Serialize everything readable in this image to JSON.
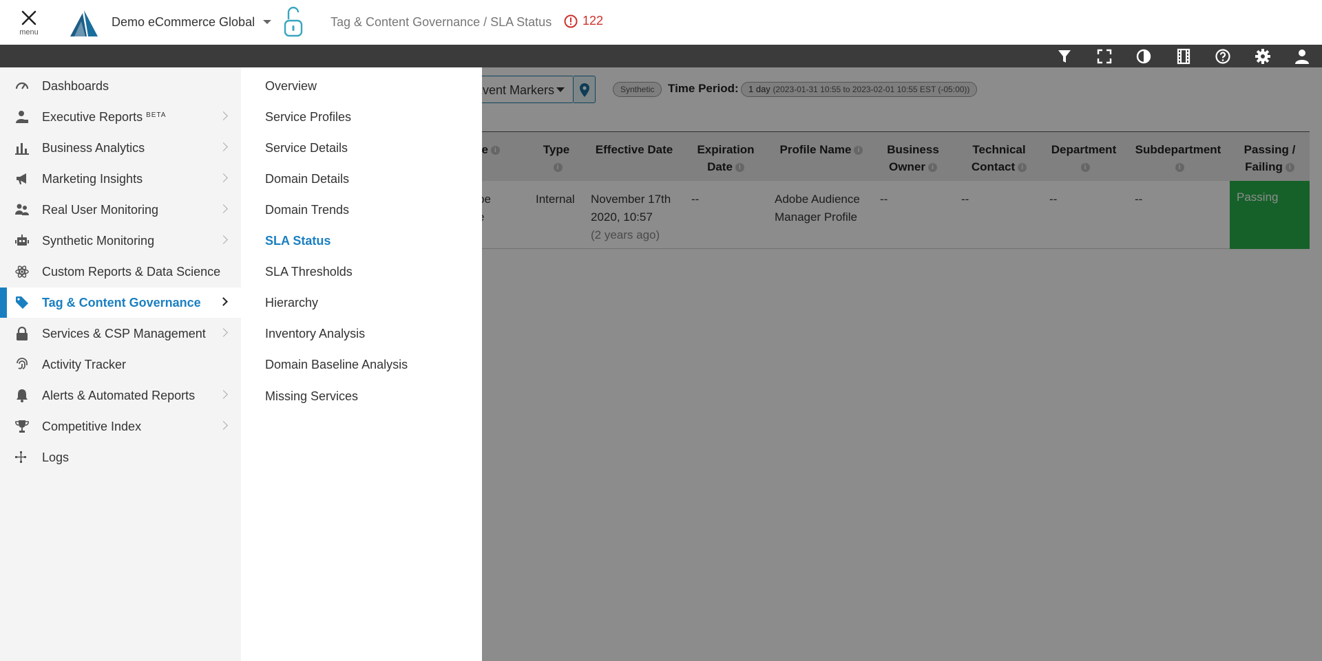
{
  "header": {
    "menu_label": "menu",
    "org_name": "Demo eCommerce Global",
    "breadcrumb": "Tag & Content Governance / SLA Status",
    "alert_count": "122",
    "alert_color": "#d0302b",
    "brand_color": "#1a6e9e"
  },
  "toolbar": {
    "icons": [
      "filter-icon",
      "fullscreen-icon",
      "contrast-icon",
      "annotations-icon",
      "help-icon",
      "settings-icon",
      "user-icon"
    ]
  },
  "filters": {
    "markers_select": "Event Markers",
    "synthetic_chip": "Synthetic",
    "time_period_label": "Time Period:",
    "time_period_value": "1 day",
    "time_period_range": "(2023-01-31 10:55 to 2023-02-01 10:55 EST (-05:00))"
  },
  "table": {
    "columns": [
      "Service",
      "Type",
      "Effective Date",
      "Expiration Date",
      "Profile Name",
      "Business Owner",
      "Technical Contact",
      "Department",
      "Subdepartment",
      "Passing / Failing"
    ],
    "col_partial": "ce",
    "row": {
      "service_frag_1": "be",
      "service_frag_2": "e",
      "type": "Internal",
      "effective_date_1": "November 17th",
      "effective_date_2": "2020, 10:57",
      "effective_date_rel": "(2 years ago)",
      "expiration_date": "--",
      "profile_name_1": "Adobe Audience",
      "profile_name_2": "Manager Profile",
      "business_owner": "--",
      "technical_contact": "--",
      "department": "--",
      "subdepartment": "--",
      "status": "Passing"
    },
    "col_expiration_1": "Expiration",
    "col_expiration_2": "Date",
    "col_business_1": "Business",
    "col_business_2": "Owner",
    "col_technical_1": "Technical",
    "col_technical_2": "Contact",
    "col_pass_1": "Passing /",
    "col_pass_2": "Failing",
    "pass_color": "#28b14b"
  },
  "sidebar": {
    "items": [
      {
        "label": "Dashboards",
        "icon": "gauge-icon",
        "has_children": false
      },
      {
        "label": "Executive Reports",
        "badge": "BETA",
        "icon": "executive-icon",
        "has_children": true
      },
      {
        "label": "Business Analytics",
        "icon": "bar-chart-icon",
        "has_children": true
      },
      {
        "label": "Marketing Insights",
        "icon": "megaphone-icon",
        "has_children": true
      },
      {
        "label": "Real User Monitoring",
        "icon": "users-icon",
        "has_children": true
      },
      {
        "label": "Synthetic Monitoring",
        "icon": "robot-icon",
        "has_children": true
      },
      {
        "label": "Custom Reports & Data Science",
        "icon": "atom-icon",
        "has_children": false
      },
      {
        "label": "Tag & Content Governance",
        "icon": "tag-icon",
        "has_children": true,
        "active": true
      },
      {
        "label": "Services & CSP Management",
        "icon": "lock-icon",
        "has_children": true
      },
      {
        "label": "Activity Tracker",
        "icon": "fingerprint-icon",
        "has_children": false
      },
      {
        "label": "Alerts & Automated Reports",
        "icon": "bell-icon",
        "has_children": true
      },
      {
        "label": "Competitive Index",
        "icon": "trophy-icon",
        "has_children": true
      },
      {
        "label": "Logs",
        "icon": "logs-icon",
        "has_children": false
      }
    ],
    "active_color": "#1a7fc1"
  },
  "submenu": {
    "items": [
      {
        "label": "Overview"
      },
      {
        "label": "Service Profiles"
      },
      {
        "label": "Service Details"
      },
      {
        "label": "Domain Details"
      },
      {
        "label": "Domain Trends"
      },
      {
        "label": "SLA Status",
        "active": true
      },
      {
        "label": "SLA Thresholds"
      },
      {
        "label": "Hierarchy"
      },
      {
        "label": "Inventory Analysis"
      },
      {
        "label": "Domain Baseline Analysis"
      },
      {
        "label": "Missing Services"
      }
    ]
  }
}
